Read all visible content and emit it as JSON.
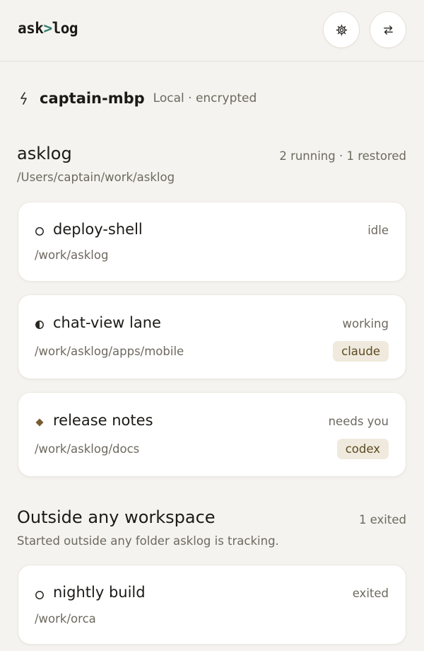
{
  "app": {
    "logo_prefix": "ask",
    "logo_symbol": ">",
    "logo_suffix": "log",
    "settings_icon": "gear-icon",
    "switch_icon": "swap-arrows-icon"
  },
  "host": {
    "icon": "lightning-icon",
    "name": "captain-mbp",
    "meta": "Local · encrypted"
  },
  "workspace": {
    "title": "asklog",
    "status": "2 running · 1 restored",
    "path": "/Users/captain/work/asklog",
    "sessions": [
      {
        "status_icon": "empty-circle-icon",
        "name": "deploy-shell",
        "state": "idle",
        "path": "/work/asklog",
        "agent": ""
      },
      {
        "status_icon": "half-circle-icon",
        "name": "chat-view lane",
        "state": "working",
        "path": "/work/asklog/apps/mobile",
        "agent": "claude"
      },
      {
        "status_icon": "diamond-icon",
        "name": "release notes",
        "state": "needs you",
        "path": "/work/asklog/docs",
        "agent": "codex"
      }
    ]
  },
  "outside": {
    "title": "Outside any workspace",
    "status": "1 exited",
    "subtitle": "Started outside any folder asklog is tracking.",
    "sessions": [
      {
        "status_icon": "empty-circle-icon",
        "name": "nightly build",
        "state": "exited",
        "path": "/work/orca"
      }
    ]
  },
  "colors": {
    "background": "#f5f3ef",
    "accent": "#2e7d6e",
    "needs_attention": "#7a5a30",
    "badge_bg": "#efeadd"
  }
}
